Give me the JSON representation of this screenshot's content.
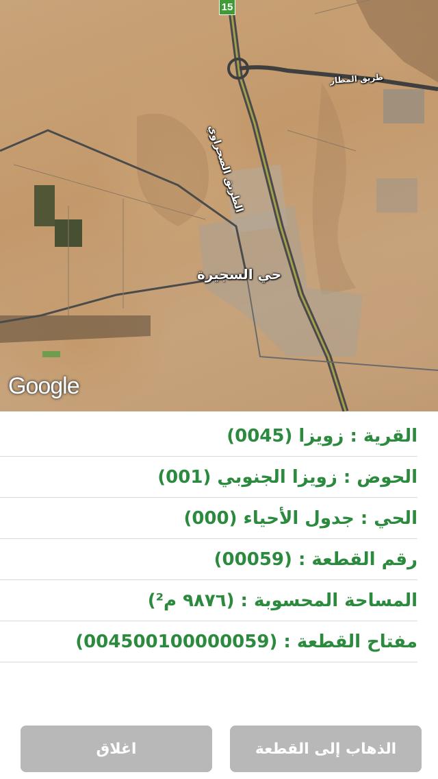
{
  "map": {
    "route_number": "15",
    "labels": {
      "neighborhood": "حي السجيرة",
      "desert_road": "الطريق الصحراوي",
      "airport_road": "طريق المطار"
    },
    "attribution": "Google"
  },
  "parcel_info": [
    "القرية : زويزا (0045)",
    "الحوض : زويزا الجنوبي (001)",
    "الحي : جدول الأحياء (000)",
    "رقم القطعة : (00059)",
    "المساحة المحسوبة : (٩٨٧٦ م²)",
    "مفتاح القطعة : (004500100000059)"
  ],
  "buttons": {
    "close": "اغلاق",
    "go_to_parcel": "الذهاب إلى القطعة"
  },
  "colors": {
    "info_text": "#2b8a3e",
    "button_bg": "#b8b8b8",
    "route_shield": "#3f9c35"
  }
}
